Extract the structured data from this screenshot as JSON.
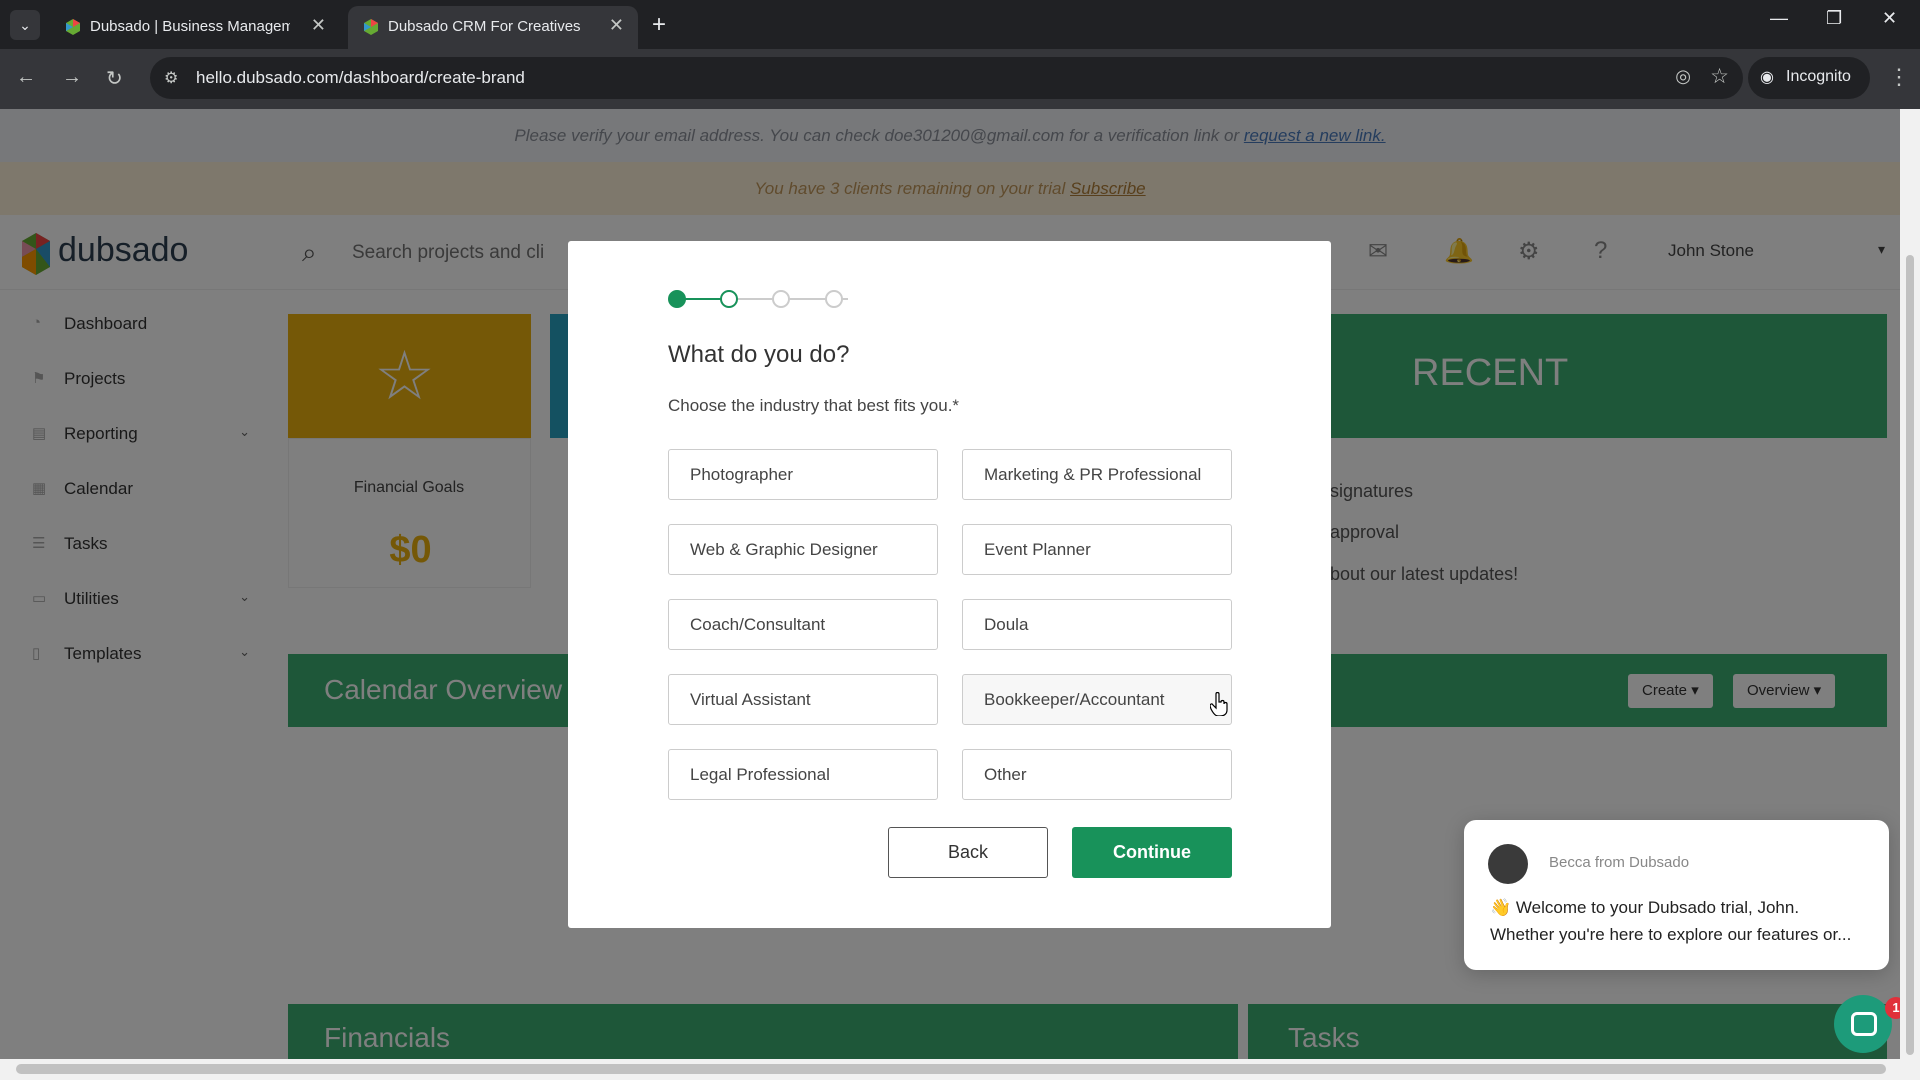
{
  "browser": {
    "tabs": [
      {
        "title": "Dubsado | Business Manageme",
        "active": false
      },
      {
        "title": "Dubsado CRM For Creatives",
        "active": true
      }
    ],
    "url": "hello.dubsado.com/dashboard/create-brand",
    "incognito_label": "Incognito"
  },
  "banners": {
    "verify_text": "Please verify your email address. You can check doe301200@gmail.com for a verification link or",
    "verify_link": "request a new link.",
    "trial_text": "You have 3 clients remaining on your trial",
    "trial_link": "Subscribe"
  },
  "header": {
    "logo": "dubsado",
    "search_placeholder": "Search projects and cli",
    "user": "John Stone"
  },
  "sidebar": {
    "items": [
      {
        "label": "Dashboard",
        "icon": "dashboard-icon"
      },
      {
        "label": "Projects",
        "icon": "projects-icon"
      },
      {
        "label": "Reporting",
        "icon": "reporting-icon"
      },
      {
        "label": "Calendar",
        "icon": "calendar-icon"
      },
      {
        "label": "Tasks",
        "icon": "tasks-icon"
      },
      {
        "label": "Utilities",
        "icon": "utilities-icon"
      },
      {
        "label": "Templates",
        "icon": "templates-icon"
      }
    ]
  },
  "dashboard": {
    "financial_label": "Financial Goals",
    "financial_value": "$0",
    "recent_title": "RECENT",
    "recent_items": [
      "signatures",
      "approval",
      "bout our latest updates!"
    ],
    "calendar_title": "Calendar Overview",
    "create_btn": "Create",
    "overview_btn": "Overview",
    "financials_title": "Financials",
    "tasks_title": "Tasks"
  },
  "modal": {
    "steps": {
      "total": 4,
      "current": 2
    },
    "title": "What do you do?",
    "subtitle": "Choose the industry that best fits you.*",
    "options": [
      "Photographer",
      "Marketing & PR Professional",
      "Web & Graphic Designer",
      "Event Planner",
      "Coach/Consultant",
      "Doula",
      "Virtual Assistant",
      "Bookkeeper/Accountant",
      "Legal Professional",
      "Other"
    ],
    "back_label": "Back",
    "continue_label": "Continue"
  },
  "chat": {
    "sender": "Becca from Dubsado",
    "line1": "👋 Welcome to your Dubsado trial, John.",
    "line2": "Whether you're here to explore our features or...",
    "badge": "1"
  },
  "colors": {
    "brand_green": "#3cae72",
    "continue_green": "#18925a",
    "yellow": "#eab10e"
  }
}
